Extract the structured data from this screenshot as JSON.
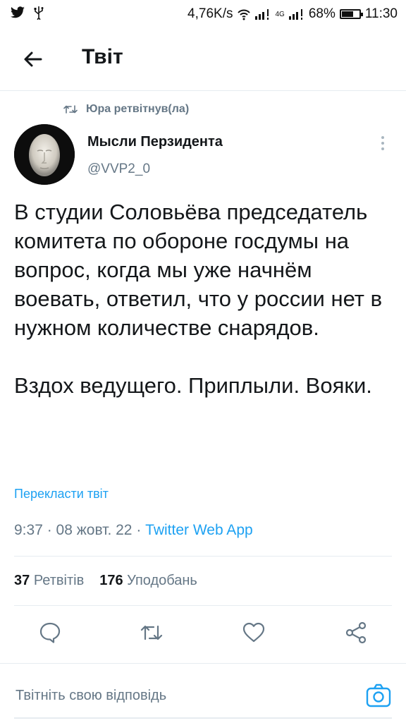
{
  "status_bar": {
    "speed": "4,76K/s",
    "network": "4G",
    "battery": "68%",
    "battery_level": 0.68,
    "time": "11:30"
  },
  "header": {
    "title": "Твіт"
  },
  "tweet": {
    "retweeted_by": "Юра ретвітнув(ла)",
    "author_name": "Мысли Перзидента",
    "author_handle": "@VVP2_0",
    "text": "В студии Соловьёва председатель комитета по обороне госдумы на вопрос, когда мы уже начнём воевать, ответил, что у россии нет в нужном количестве снарядов.\n\nВздох ведущего. Приплыли. Вояки.",
    "translate_label": "Перекласти твіт",
    "time": "9:37",
    "date": "08 жовт. 22",
    "separator": " · ",
    "source": "Twitter Web App",
    "retweets_count": "37",
    "retweets_label": "Ретвітів",
    "likes_count": "176",
    "likes_label": "Уподобань"
  },
  "reply": {
    "placeholder": "Твітніть свою відповідь"
  },
  "colors": {
    "accent": "#1da1f2",
    "secondary_text": "#657786",
    "divider": "#e6ecf0"
  }
}
